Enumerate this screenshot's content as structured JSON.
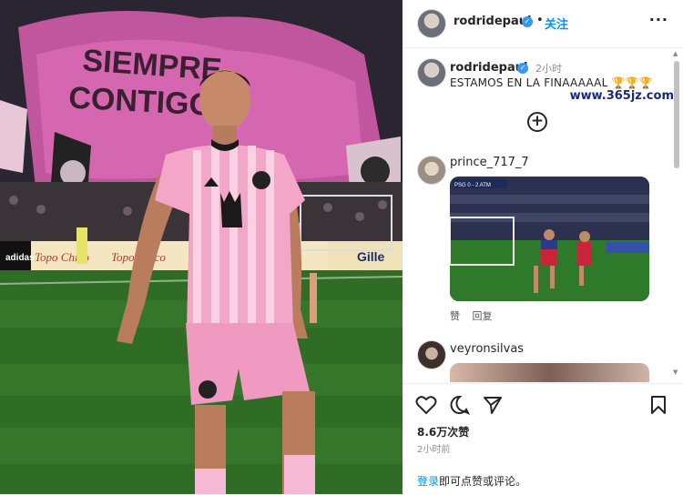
{
  "photo": {
    "banner_text_1": "SIEMPRE",
    "banner_text_2": "CONTIGO",
    "ad_text_1": "Topo Chico",
    "ad_text_2": "Topo Chico",
    "ad_text_3": "Gille",
    "ad_logo": "adidas",
    "jersey_sponsor": "royal caribbean crown"
  },
  "header": {
    "username": "rodridepaul",
    "separator": "•",
    "follow_label": "关注",
    "more_label": "···"
  },
  "caption": {
    "username": "rodridepaul",
    "time": "2小时",
    "text": "ESTAMOS EN LA FINAAAAAL 🏆🏆🏆"
  },
  "comments": [
    {
      "username": "prince_717_7",
      "video_score": "PSG 0 - 2 ATM",
      "like_label": "赞",
      "reply_label": "回复"
    },
    {
      "username": "veyronsilvas"
    }
  ],
  "footer": {
    "likes": "8.6万次赞",
    "time": "2小时前",
    "login_label": "登录",
    "login_suffix": "即可点赞或评论。",
    "watermark": "www.365jz.com"
  },
  "colors": {
    "accent": "#0095f6",
    "verified": "#3897f0",
    "jersey_pink": "#f4a6c8"
  }
}
